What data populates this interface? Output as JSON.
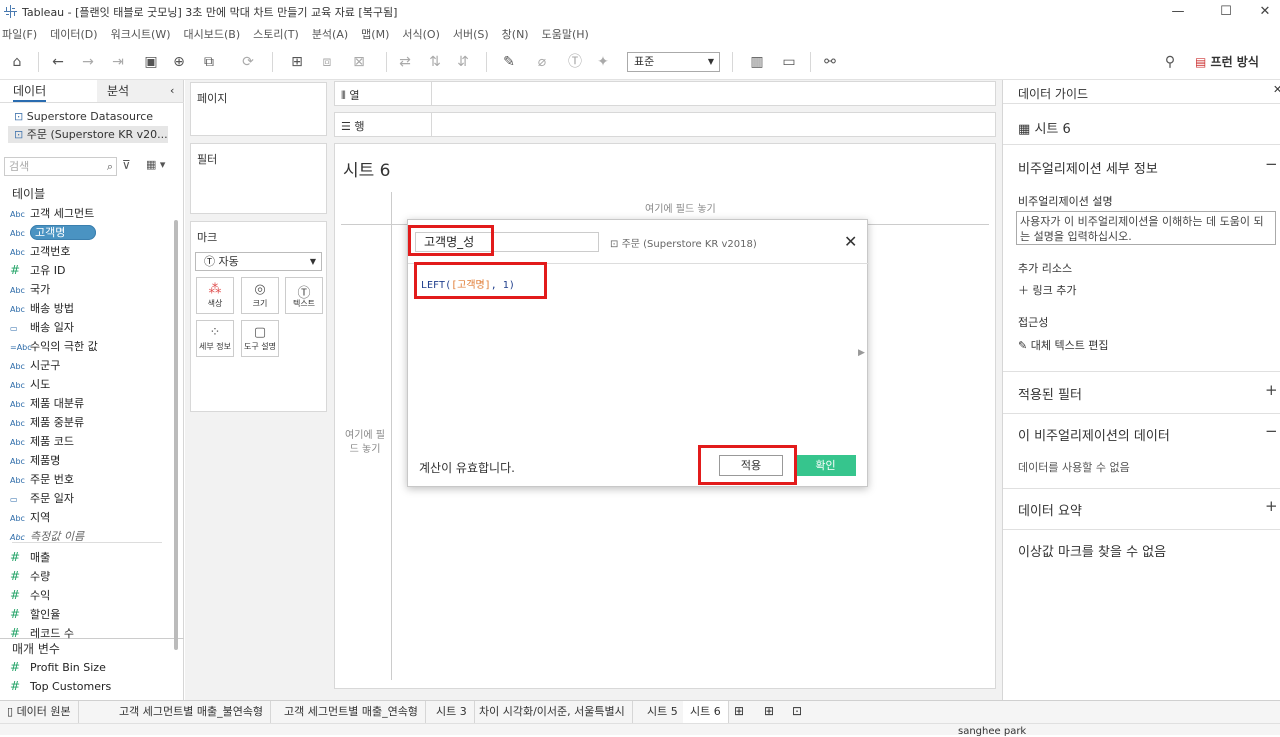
{
  "window": {
    "title": "Tableau - [플랜잇 태블로 굿모닝] 3초 만에 막대 차트 만들기 교육 자료 [복구됨]"
  },
  "menu": [
    "파일(F)",
    "데이터(D)",
    "워크시트(W)",
    "대시보드(B)",
    "스토리(T)",
    "분석(A)",
    "맵(M)",
    "서식(O)",
    "서버(S)",
    "창(N)",
    "도움말(H)"
  ],
  "toolbar": {
    "fit": "표준",
    "present": "프런 방식"
  },
  "leftpanel": {
    "tab_data": "데이터",
    "tab_analysis": "분석",
    "datasource1": "Superstore Datasource",
    "datasource2": "주문 (Superstore KR v20...",
    "search_placeholder": "검색",
    "tables_label": "테이블",
    "fields": [
      {
        "type": "Abc",
        "name": "고객 세그먼트"
      },
      {
        "type": "Abc",
        "name": "고객명"
      },
      {
        "type": "Abc",
        "name": "고객번호"
      },
      {
        "type": "#",
        "name": "고유 ID"
      },
      {
        "type": "Abc",
        "name": "국가"
      },
      {
        "type": "Abc",
        "name": "배송 방법"
      },
      {
        "type": "cal",
        "name": "배송 일자"
      },
      {
        "type": "=Abc",
        "name": "수익의 극한 값"
      },
      {
        "type": "Abc",
        "name": "시군구"
      },
      {
        "type": "Abc",
        "name": "시도"
      },
      {
        "type": "Abc",
        "name": "제품 대분류"
      },
      {
        "type": "Abc",
        "name": "제품 중분류"
      },
      {
        "type": "Abc",
        "name": "제품 코드"
      },
      {
        "type": "Abc",
        "name": "제품명"
      },
      {
        "type": "Abc",
        "name": "주문 번호"
      },
      {
        "type": "cal",
        "name": "주문 일자"
      },
      {
        "type": "Abc",
        "name": "지역"
      },
      {
        "type": "Abc",
        "name": "측정값 이름"
      },
      {
        "type": "#",
        "name": "매출"
      },
      {
        "type": "#",
        "name": "수량"
      },
      {
        "type": "#",
        "name": "수익"
      },
      {
        "type": "#",
        "name": "할인율"
      },
      {
        "type": "#",
        "name": "레코드 수"
      }
    ],
    "params_label": "매개 변수",
    "params": [
      {
        "type": "#",
        "name": "Profit Bin Size"
      },
      {
        "type": "#",
        "name": "Top Customers"
      }
    ]
  },
  "shelves": {
    "pages": "페이지",
    "filters": "필터",
    "marks": "마크",
    "mark_type": "자동",
    "mark_buttons": [
      "색상",
      "크기",
      "텍스트",
      "세부 정보",
      "도구 설명"
    ]
  },
  "viz": {
    "columns": "열",
    "rows": "행",
    "sheet_title": "시트 6",
    "drop_top": "여기에 필드 놓기",
    "drop_left": "여기에 필드 놓기"
  },
  "calc_dialog": {
    "name": "고객명_성",
    "source": "주문 (Superstore KR v2018)",
    "formula_fn": "LEFT(",
    "formula_field": "[고객명]",
    "formula_rest": ", 1)",
    "valid_msg": "계산이 유효합니다.",
    "apply": "적용",
    "ok": "확인"
  },
  "rightpanel": {
    "title": "데이터 가이드",
    "sheet": "시트 6",
    "viz_detail": "비주얼리제이션 세부 정보",
    "viz_desc_label": "비주얼리제이션 설명",
    "viz_desc": "사용자가 이 비주얼리제이션을 이해하는 데 도움이 되는 설명을 입력하십시오.",
    "resources": "추가 리소스",
    "add_link": "링크 추가",
    "access": "접근성",
    "alt_text": "대체 텍스트 편집",
    "applied_filters": "적용된 필터",
    "viz_data": "이 비주얼리제이션의 데이터",
    "data_unavailable": "데이터를 사용할 수 없음",
    "data_summary": "데이터 요약",
    "outliers": "이상값 마크를 찾을 수 없음"
  },
  "tabs": [
    "데이터 원본",
    "고객 세그먼트별 매출_불연속형",
    "고객 세그먼트별 매출_연속형",
    "시트 3",
    "차이 시각화/이서준, 서울특별시",
    "시트 5",
    "시트 6"
  ],
  "status": {
    "user": "sanghee park"
  },
  "colors": {
    "accent": "#36c58d",
    "highlight": "#e21b1b",
    "selected": "#4a93c2"
  }
}
